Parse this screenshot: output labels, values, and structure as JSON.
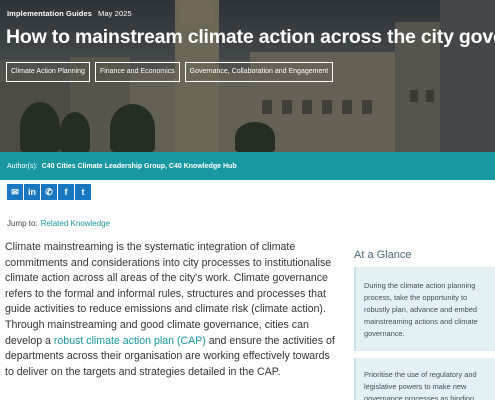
{
  "hero": {
    "category": "Implementation Guides",
    "date": "May 2025",
    "title": "How to mainstream climate action across the city government",
    "tags": [
      "Climate Action Planning",
      "Finance and Economics",
      "Governance, Collaboration and Engagement"
    ]
  },
  "author": {
    "label": "Author(s):",
    "names": "C40 Cities Climate Leadership Group, C40 Knowledge Hub"
  },
  "share": {
    "icons": [
      "email-icon",
      "linkedin-icon",
      "whatsapp-icon",
      "facebook-icon",
      "twitter-icon"
    ],
    "glyphs": [
      "✉",
      "in",
      "✆",
      "f",
      "t"
    ],
    "color": "#1a78c2"
  },
  "jump": {
    "label": "Jump to:",
    "link": "Related Knowledge"
  },
  "body": {
    "part1": "Climate mainstreaming is the systematic integration of climate commitments and considerations into city processes to institutionalise climate action across all areas of the city's work. Climate governance refers to the formal and informal rules, structures and processes that guide activities to reduce emissions and climate risk (climate action). Through mainstreaming and good climate governance, cities can develop a ",
    "link": "robust climate action plan (CAP)",
    "part2": " and ensure the activities of departments across their organisation are working effectively towards to deliver on the targets and strategies detailed in the CAP."
  },
  "glance": {
    "title": "At a Glance",
    "cards": [
      "During the climate action planning process, take the opportunity to robustly plan, advance and embed mainstreaming actions and climate governance.",
      "Prioritise the use of regulatory and legislative powers to make new governance processes as binding"
    ]
  },
  "colors": {
    "accent": "#1897a1",
    "share": "#1a78c2",
    "card_bg": "#e4f1f4"
  }
}
